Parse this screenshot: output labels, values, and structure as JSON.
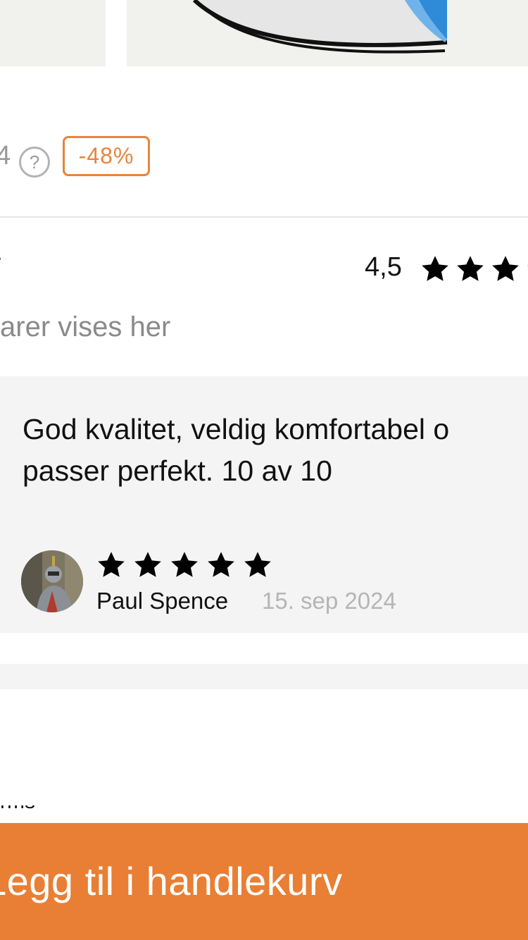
{
  "product": {
    "price_fragment": "4",
    "help_symbol": "?",
    "discount_badge": "-48%",
    "image_colors": {
      "background": "#f1f1ee",
      "accent_blue": "#2f8ad8",
      "stripe": "#111111"
    }
  },
  "reviews": {
    "title_fragment": "r",
    "average_rating": "4,5",
    "average_stars": 4.5,
    "subtitle": "arer vises her",
    "items": [
      {
        "text": "God kvalitet, veldig komfortabel o\npasser perfekt. 10 av 10",
        "stars": 5,
        "reviewer": "Paul Spence",
        "date": "15. sep 2024",
        "avatar_icon": "avatar-photo"
      }
    ]
  },
  "footer_fragment": "rms",
  "cart": {
    "label": "Legg til i handlekurv",
    "color": "#e87f34"
  },
  "colors": {
    "discount": "#e8843a",
    "card_bg": "#f4f4f4",
    "muted_text": "#8a8a8a"
  }
}
